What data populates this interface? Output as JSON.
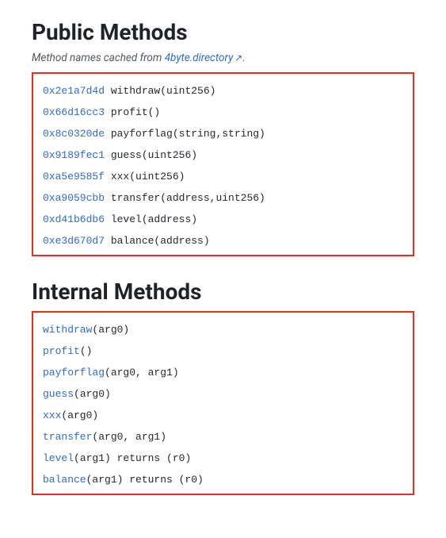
{
  "public": {
    "title": "Public Methods",
    "caption_prefix": "Method names cached from ",
    "caption_link_text": "4byte.directory",
    "caption_suffix": ".",
    "methods": [
      {
        "selector": "0x2e1a7d4d",
        "name": "withdraw",
        "args": "(uint256)"
      },
      {
        "selector": "0x66d16cc3",
        "name": "profit",
        "args": "()"
      },
      {
        "selector": "0x8c0320de",
        "name": "payforflag",
        "args": "(string,string)"
      },
      {
        "selector": "0x9189fec1",
        "name": "guess",
        "args": "(uint256)"
      },
      {
        "selector": "0xa5e9585f",
        "name": "xxx",
        "args": "(uint256)"
      },
      {
        "selector": "0xa9059cbb",
        "name": "transfer",
        "args": "(address,uint256)"
      },
      {
        "selector": "0xd41b6db6",
        "name": "level",
        "args": "(address)"
      },
      {
        "selector": "0xe3d670d7",
        "name": "balance",
        "args": "(address)"
      }
    ]
  },
  "internal": {
    "title": "Internal Methods",
    "methods": [
      {
        "name": "withdraw",
        "rest": "(arg0)"
      },
      {
        "name": "profit",
        "rest": "()"
      },
      {
        "name": "payforflag",
        "rest": "(arg0, arg1)"
      },
      {
        "name": "guess",
        "rest": "(arg0)"
      },
      {
        "name": "xxx",
        "rest": "(arg0)"
      },
      {
        "name": "transfer",
        "rest": "(arg0, arg1)"
      },
      {
        "name": "level",
        "rest": "(arg1) returns (r0)"
      },
      {
        "name": "balance",
        "rest": "(arg1) returns (r0)"
      }
    ]
  }
}
